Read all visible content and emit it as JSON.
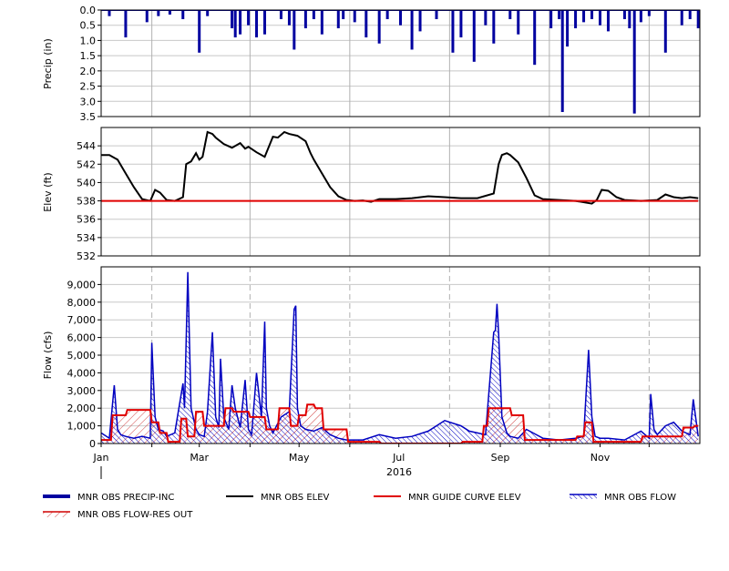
{
  "chart_data": [
    {
      "type": "bar",
      "name": "precipitation-panel",
      "ylabel": "Precip (in)",
      "ylim": [
        0,
        3.5
      ],
      "y_reversed": true,
      "yticks": [
        0.0,
        0.5,
        1.0,
        1.5,
        2.0,
        2.5,
        3.0,
        3.5
      ],
      "ytick_labels": [
        "0.0",
        "0.5",
        "1.0",
        "1.5",
        "2.0",
        "2.5",
        "3.0",
        "3.5"
      ],
      "grid": true,
      "series": [
        {
          "name": "MNR OBS PRECIP-INC",
          "color": "#0000a0",
          "x": [
            5,
            15,
            28,
            35,
            42,
            50,
            60,
            65,
            80,
            82,
            85,
            90,
            95,
            100,
            110,
            115,
            118,
            125,
            130,
            135,
            145,
            148,
            155,
            162,
            170,
            175,
            183,
            190,
            195,
            205,
            215,
            220,
            228,
            235,
            240,
            250,
            255,
            265,
            275,
            280,
            282,
            285,
            290,
            295,
            300,
            305,
            310,
            320,
            323,
            326,
            330,
            335,
            345,
            355,
            360,
            365
          ],
          "values": [
            0.2,
            0.9,
            0.4,
            0.2,
            0.15,
            0.3,
            1.4,
            0.2,
            0.6,
            0.9,
            0.8,
            0.5,
            0.9,
            0.8,
            0.3,
            0.5,
            1.3,
            0.6,
            0.3,
            0.8,
            0.6,
            0.3,
            0.4,
            0.9,
            1.1,
            0.3,
            0.5,
            1.3,
            0.7,
            0.3,
            1.4,
            0.9,
            1.7,
            0.5,
            1.1,
            0.3,
            0.8,
            1.8,
            0.6,
            0.3,
            3.35,
            1.2,
            0.6,
            0.4,
            0.3,
            0.5,
            0.7,
            0.3,
            0.6,
            3.4,
            0.4,
            0.2,
            1.4,
            0.5,
            0.3,
            0.6
          ]
        }
      ]
    },
    {
      "type": "line",
      "name": "elevation-panel",
      "ylabel": "Elev (ft)",
      "ylim": [
        532,
        546
      ],
      "yticks": [
        532,
        534,
        536,
        538,
        540,
        542,
        544
      ],
      "ytick_labels": [
        "532",
        "534",
        "536",
        "538",
        "540",
        "542",
        "544"
      ],
      "grid": true,
      "series": [
        {
          "name": "MNR OBS ELEV",
          "color": "#000000",
          "x": [
            0,
            5,
            10,
            15,
            20,
            25,
            30,
            33,
            36,
            40,
            45,
            50,
            52,
            55,
            58,
            60,
            62,
            65,
            68,
            70,
            75,
            80,
            85,
            88,
            90,
            95,
            100,
            105,
            108,
            112,
            115,
            120,
            125,
            128,
            130,
            135,
            140,
            145,
            150,
            155,
            160,
            165,
            170,
            175,
            180,
            190,
            200,
            210,
            220,
            230,
            240,
            243,
            245,
            248,
            250,
            255,
            260,
            265,
            270,
            280,
            290,
            300,
            303,
            306,
            310,
            315,
            320,
            330,
            340,
            345,
            350,
            355,
            360,
            365
          ],
          "values": [
            543,
            543,
            542.5,
            541,
            539.5,
            538.2,
            538,
            539.2,
            538.9,
            538.1,
            538,
            538.4,
            542,
            542.3,
            543.2,
            542.5,
            542.8,
            545.5,
            545.3,
            544.9,
            544.2,
            543.8,
            544.3,
            543.7,
            543.9,
            543.3,
            542.8,
            545,
            544.9,
            545.5,
            545.3,
            545.1,
            544.5,
            543.2,
            542.5,
            541,
            539.5,
            538.5,
            538.1,
            538,
            538.05,
            537.9,
            538.2,
            538.2,
            538.2,
            538.3,
            538.5,
            538.4,
            538.3,
            538.3,
            538.8,
            542,
            543,
            543.2,
            543,
            542.2,
            540.5,
            538.6,
            538.2,
            538.1,
            538,
            537.7,
            538.1,
            539.2,
            539.1,
            538.4,
            538.1,
            538,
            538.1,
            538.7,
            538.4,
            538.3,
            538.4,
            538.3
          ]
        },
        {
          "name": "MNR GUIDE CURVE ELEV",
          "color": "#e00000",
          "x": [
            0,
            365
          ],
          "values": [
            538,
            538
          ]
        }
      ]
    },
    {
      "type": "area",
      "name": "flow-panel",
      "ylabel": "Flow (cfs)",
      "xlabel": "2016",
      "ylim": [
        0,
        10000
      ],
      "yticks": [
        0,
        1000,
        2000,
        3000,
        4000,
        5000,
        6000,
        7000,
        8000,
        9000
      ],
      "ytick_labels": [
        "0",
        "1,000",
        "2,000",
        "3,000",
        "4,000",
        "5,000",
        "6,000",
        "7,000",
        "8,000",
        "9,000"
      ],
      "xticks": [
        0,
        60,
        121,
        182,
        244,
        305
      ],
      "xtick_labels": [
        "Jan",
        "Mar",
        "May",
        "Jul",
        "Sep",
        "Nov"
      ],
      "xlim": [
        0,
        366
      ],
      "grid": true,
      "series": [
        {
          "name": "MNR OBS FLOW",
          "color": "#0000c0",
          "x": [
            0,
            5,
            8,
            10,
            12,
            15,
            20,
            25,
            30,
            31,
            33,
            35,
            38,
            40,
            45,
            50,
            51,
            53,
            55,
            58,
            60,
            63,
            65,
            68,
            70,
            72,
            73,
            75,
            78,
            80,
            82,
            85,
            88,
            90,
            92,
            95,
            98,
            100,
            101,
            103,
            105,
            110,
            115,
            118,
            119,
            120,
            122,
            125,
            130,
            135,
            140,
            145,
            150,
            160,
            170,
            180,
            190,
            200,
            210,
            220,
            225,
            230,
            235,
            240,
            241,
            242,
            243,
            245,
            248,
            250,
            255,
            260,
            270,
            280,
            290,
            295,
            298,
            300,
            302,
            305,
            310,
            320,
            330,
            335,
            336,
            338,
            340,
            345,
            350,
            355,
            360,
            362,
            365
          ],
          "values": [
            600,
            300,
            3300,
            800,
            500,
            400,
            300,
            400,
            300,
            5700,
            1500,
            800,
            700,
            400,
            600,
            3400,
            2000,
            9700,
            2000,
            800,
            500,
            400,
            1800,
            6300,
            1500,
            900,
            4800,
            1500,
            800,
            3300,
            2000,
            900,
            3600,
            800,
            500,
            4000,
            1500,
            6900,
            2000,
            1000,
            600,
            1500,
            1800,
            7600,
            7800,
            2000,
            1000,
            800,
            700,
            900,
            500,
            300,
            200,
            200,
            500,
            300,
            400,
            700,
            1300,
            1000,
            700,
            600,
            500,
            6300,
            6400,
            7900,
            6200,
            1500,
            600,
            400,
            300,
            800,
            300,
            200,
            300,
            400,
            5300,
            1500,
            400,
            300,
            300,
            200,
            700,
            300,
            2800,
            800,
            500,
            1000,
            1200,
            700,
            500,
            2500,
            400
          ]
        },
        {
          "name": "MNR GUIDE CURVE ELEV",
          "color": "#e00000",
          "x": [
            0,
            6,
            7,
            15,
            16,
            30,
            31,
            35,
            36,
            40,
            41,
            48,
            49,
            52,
            53,
            57,
            58,
            62,
            63,
            75,
            76,
            80,
            81,
            90,
            91,
            100,
            101,
            108,
            109,
            115,
            116,
            120,
            121,
            125,
            126,
            130,
            131,
            135,
            136,
            150,
            151,
            158,
            159,
            170,
            171,
            220,
            221,
            233,
            234,
            236,
            237,
            250,
            251,
            258,
            259,
            290,
            291,
            295,
            296,
            300,
            301,
            330,
            331,
            355,
            356,
            362,
            363,
            365
          ],
          "values": [
            200,
            200,
            1600,
            1600,
            1900,
            1900,
            1200,
            1200,
            600,
            600,
            100,
            100,
            1400,
            1400,
            400,
            400,
            1800,
            1800,
            1000,
            1000,
            2000,
            2000,
            1800,
            1800,
            1500,
            1500,
            800,
            800,
            2000,
            2000,
            1000,
            1000,
            1600,
            1600,
            2200,
            2200,
            2000,
            2000,
            800,
            800,
            100,
            100,
            100,
            100,
            0,
            0,
            100,
            100,
            1000,
            1000,
            2000,
            2000,
            1600,
            1600,
            200,
            200,
            400,
            400,
            1200,
            1200,
            100,
            100,
            400,
            400,
            900,
            900,
            1000,
            1000
          ]
        }
      ]
    }
  ],
  "legend": {
    "placement": "bottom",
    "items": [
      {
        "label": "MNR OBS PRECIP-INC",
        "style": "thick-line",
        "color": "#0000a0"
      },
      {
        "label": "MNR OBS ELEV",
        "style": "line",
        "color": "#000000"
      },
      {
        "label": "MNR GUIDE CURVE ELEV",
        "style": "line",
        "color": "#e00000"
      },
      {
        "label": "MNR OBS FLOW",
        "style": "hatch-line",
        "color": "#0000c0"
      },
      {
        "label": "MNR OBS FLOW-RES OUT",
        "style": "hatch",
        "color": "#d00000"
      }
    ]
  }
}
